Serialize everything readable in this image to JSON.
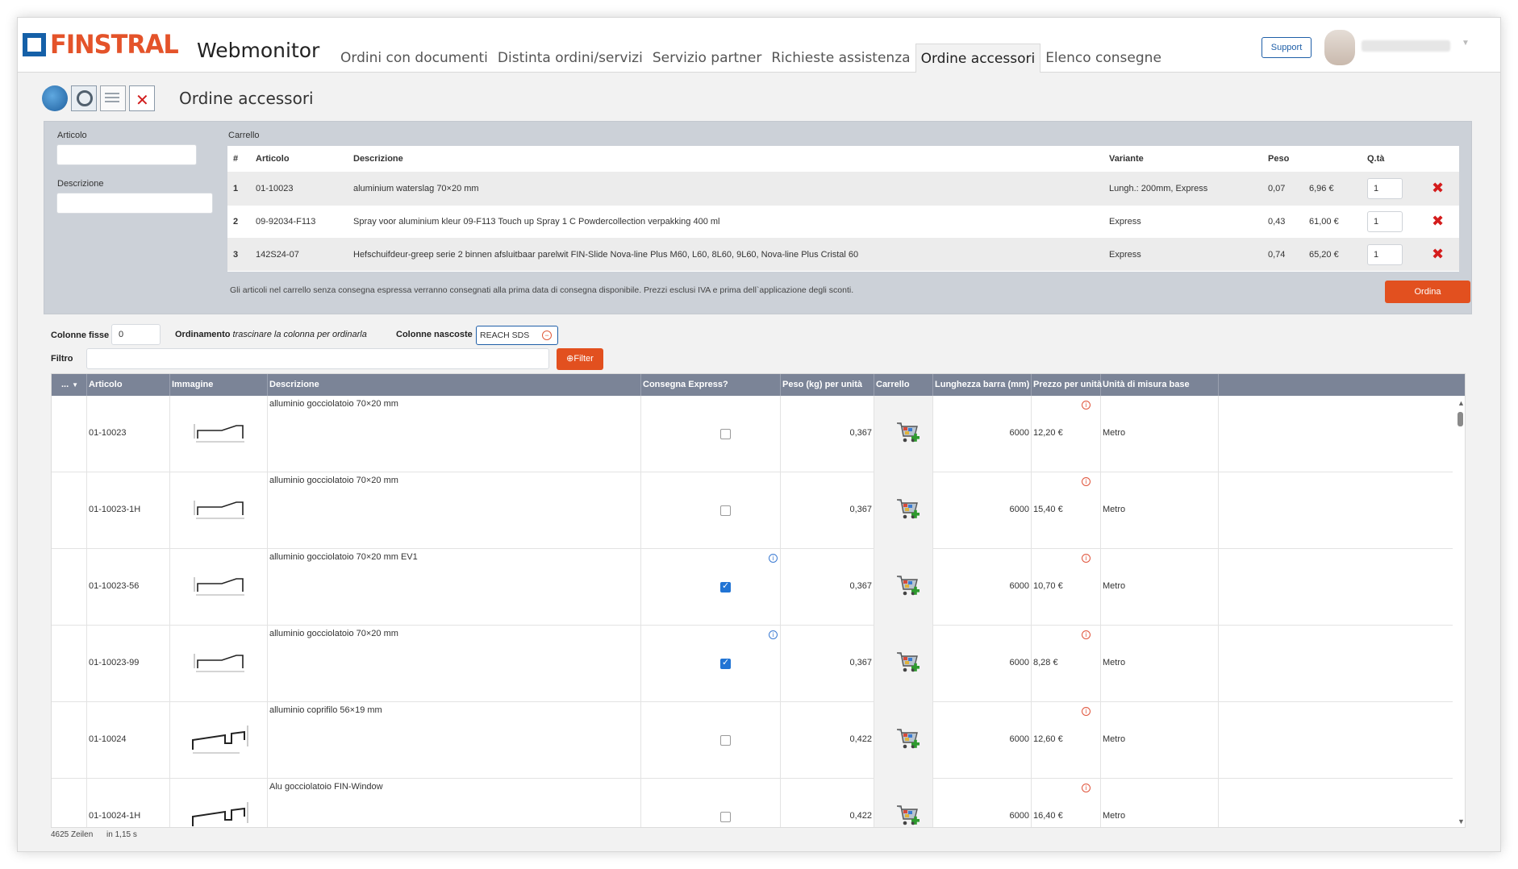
{
  "app": {
    "brand": "FINSTRAL",
    "name": "Webmonitor",
    "support_label": "Support"
  },
  "nav": {
    "tabs": [
      {
        "label": "Ordini con documenti"
      },
      {
        "label": "Distinta ordini/servizi"
      },
      {
        "label": "Servizio partner"
      },
      {
        "label": "Richieste assistenza"
      },
      {
        "label": "Ordine accessori",
        "active": true
      },
      {
        "label": "Elenco consegne"
      }
    ]
  },
  "toolbar": {
    "icons": [
      "refresh-icon",
      "search-icon",
      "document-icon",
      "cancel-icon"
    ],
    "page_title": "Ordine accessori"
  },
  "search": {
    "articolo_label": "Articolo",
    "articolo_value": "",
    "descrizione_label": "Descrizione",
    "descrizione_value": ""
  },
  "cart": {
    "title": "Carrello",
    "headers": [
      "#",
      "Articolo",
      "Descrizione",
      "Variante",
      "Peso",
      "",
      "Q.tà",
      ""
    ],
    "rows": [
      {
        "num": "1",
        "articolo": "01-10023",
        "descrizione": "aluminium waterslag 70×20 mm",
        "variante": "Lungh.: 200mm, Express",
        "peso": "0,07",
        "prezzo": "6,96 €",
        "qta": "1"
      },
      {
        "num": "2",
        "articolo": "09-92034-F113",
        "descrizione": "Spray voor aluminium kleur 09-F113 Touch up Spray 1 C Powdercollection verpakking 400 ml",
        "variante": "Express",
        "peso": "0,43",
        "prezzo": "61,00 €",
        "qta": "1"
      },
      {
        "num": "3",
        "articolo": "142S24-07",
        "descrizione": "Hefschuifdeur-greep serie 2 binnen afsluitbaar parelwit FIN-Slide Nova-line Plus M60, L60, 8L60, 9L60, Nova-line Plus Cristal 60",
        "variante": "Express",
        "peso": "0,74",
        "prezzo": "65,20 €",
        "qta": "1"
      }
    ],
    "note": "Gli articoli nel carrello senza consegna espressa verranno consegnati alla prima data di consegna disponibile. Prezzi esclusi IVA e prima dell`applicazione degli sconti.",
    "order_button": "Ordina"
  },
  "grid_controls": {
    "colonne_fisse_label": "Colonne fisse",
    "colonne_fisse_value": "0",
    "ordinamento_label": "Ordinamento",
    "ordinamento_hint": "trascinare la colonna per ordinarla",
    "colonne_nascoste_label": "Colonne nascoste",
    "hidden_column_chip": "REACH SDS",
    "filtro_label": "Filtro",
    "filtro_value": "",
    "filter_button": "⊕Filter"
  },
  "grid": {
    "menu_label": "...",
    "columns": [
      "Articolo",
      "Immagine",
      "Descrizione",
      "Consegna Express?",
      "Peso (kg) per unità",
      "Carrello",
      "Lunghezza barra (mm)",
      "Prezzo per unità",
      "Unità di misura base"
    ],
    "rows": [
      {
        "articolo": "01-10023",
        "profile": "drip",
        "descrizione": "alluminio gocciolatoio 70×20 mm",
        "express": false,
        "express_info": false,
        "peso": "0,367",
        "lunghezza": "6000",
        "prezzo": "12,20 €",
        "unita": "Metro"
      },
      {
        "articolo": "01-10023-1H",
        "profile": "drip",
        "descrizione": "alluminio gocciolatoio 70×20 mm",
        "express": false,
        "express_info": false,
        "peso": "0,367",
        "lunghezza": "6000",
        "prezzo": "15,40 €",
        "unita": "Metro"
      },
      {
        "articolo": "01-10023-56",
        "profile": "drip",
        "descrizione": "alluminio gocciolatoio 70×20 mm EV1",
        "express": true,
        "express_info": true,
        "peso": "0,367",
        "lunghezza": "6000",
        "prezzo": "10,70 €",
        "unita": "Metro"
      },
      {
        "articolo": "01-10023-99",
        "profile": "drip",
        "descrizione": "alluminio gocciolatoio 70×20 mm",
        "express": true,
        "express_info": true,
        "peso": "0,367",
        "lunghezza": "6000",
        "prezzo": "8,28 €",
        "unita": "Metro"
      },
      {
        "articolo": "01-10024",
        "profile": "cover",
        "descrizione": "alluminio coprifilo 56×19 mm",
        "express": false,
        "express_info": false,
        "peso": "0,422",
        "lunghezza": "6000",
        "prezzo": "12,60 €",
        "unita": "Metro"
      },
      {
        "articolo": "01-10024-1H",
        "profile": "cover",
        "descrizione": "Alu gocciolatoio FIN-Window",
        "express": false,
        "express_info": false,
        "peso": "0,422",
        "lunghezza": "6000",
        "prezzo": "16,40 €",
        "unita": "Metro"
      }
    ]
  },
  "footer": {
    "rows_count": "4625 Zeilen",
    "time": "in 1,15 s"
  },
  "colors": {
    "brand_orange": "#e2501f",
    "brand_blue": "#1560a8",
    "grid_header": "#7b8497"
  }
}
